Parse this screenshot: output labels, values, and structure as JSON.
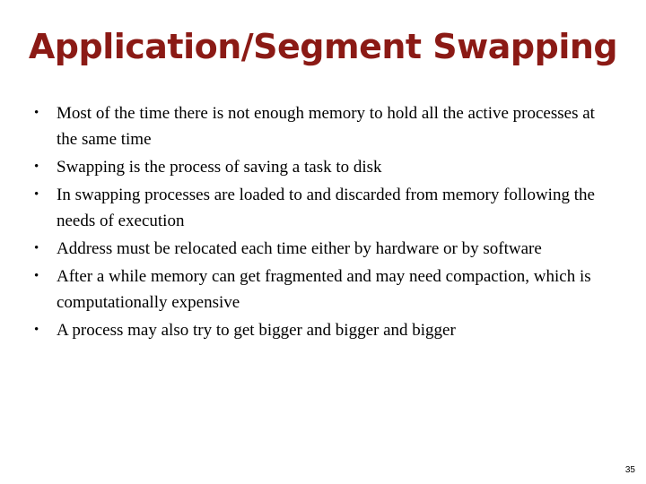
{
  "slide": {
    "title": "Application/Segment Swapping",
    "bullets": [
      "Most of the time there is not enough memory to hold all the active processes at the same time",
      "Swapping is the process of saving a task to disk",
      "In swapping processes are loaded to and discarded from memory following the needs of execution",
      "Address must be relocated each time either by hardware or by software",
      "After a while memory can get fragmented and may need compaction, which is computationally expensive",
      "A process may also try to get bigger and bigger and bigger"
    ],
    "bullet_symbol": "•",
    "page_number": "35",
    "title_color": "#8B1A15"
  }
}
